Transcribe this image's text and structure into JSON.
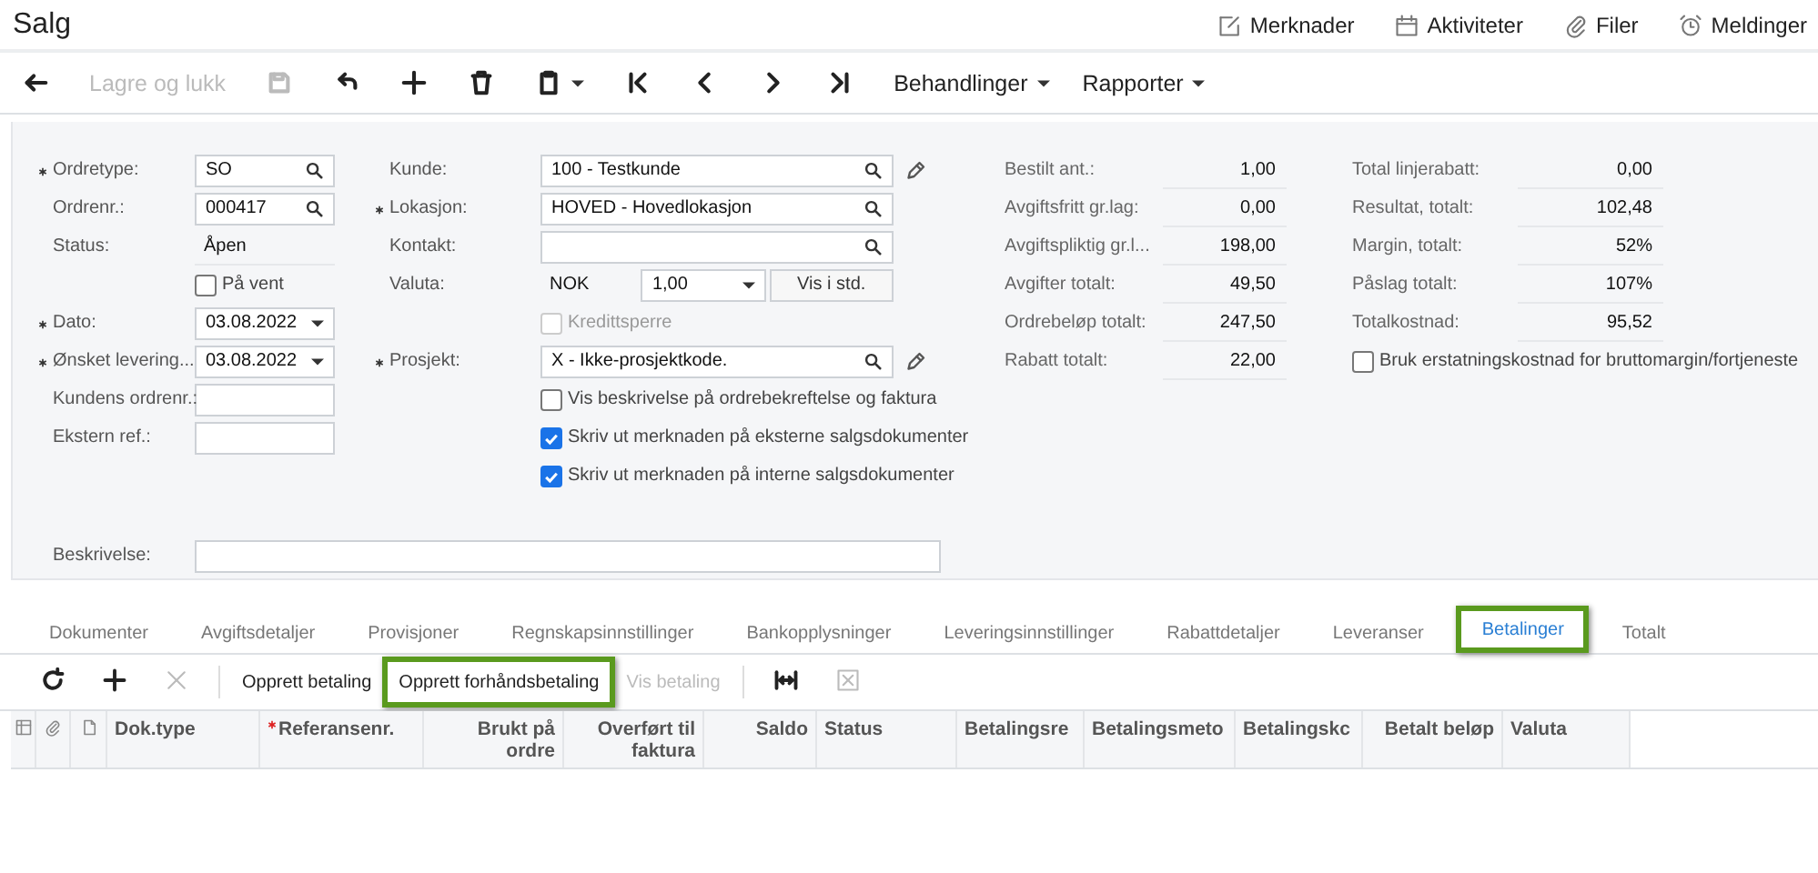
{
  "window": {
    "title": "Salg"
  },
  "header_links": [
    {
      "label": "Merknader"
    },
    {
      "label": "Aktiviteter"
    },
    {
      "label": "Filer"
    },
    {
      "label": "Meldinger"
    }
  ],
  "toolbar": [
    {
      "kind": "icon",
      "disabled": false
    },
    {
      "kind": "text",
      "label": "Lagre og lukk",
      "disabled": true
    },
    {
      "kind": "icon",
      "disabled": true
    },
    {
      "kind": "icon",
      "disabled": false
    },
    {
      "kind": "icon",
      "disabled": false
    },
    {
      "kind": "icon",
      "disabled": false
    },
    {
      "kind": "icon-menu",
      "disabled": false
    },
    {
      "kind": "icon",
      "disabled": false
    },
    {
      "kind": "icon",
      "disabled": false
    },
    {
      "kind": "icon",
      "disabled": false
    },
    {
      "kind": "icon",
      "disabled": false
    },
    {
      "kind": "menu",
      "label": "Behandlinger",
      "disabled": false
    },
    {
      "kind": "menu",
      "label": "Rapporter",
      "disabled": false
    }
  ],
  "form": {
    "column_1": [
      {
        "kind": "lookup",
        "label": "Ordretype:",
        "required": true,
        "value": "SO"
      },
      {
        "kind": "lookup",
        "label": "Ordrenr.:",
        "required": false,
        "value": "000417"
      },
      {
        "kind": "text",
        "label": "Status:",
        "required": false,
        "value": "Åpen"
      },
      {
        "kind": "checkbox",
        "label": "På vent",
        "checked": false,
        "disabled": false
      },
      {
        "kind": "date",
        "label": "Dato:",
        "required": true,
        "value": "03.08.2022"
      },
      {
        "kind": "date",
        "label": "Ønsket levering...",
        "required": true,
        "value": "03.08.2022"
      },
      {
        "kind": "input",
        "label": "Kundens ordrenr.:",
        "required": false
      },
      {
        "kind": "input",
        "label": "Ekstern ref.:",
        "required": false
      }
    ],
    "column_2": [
      {
        "kind": "lookup",
        "label": "Kunde:",
        "required": false,
        "value": "100 - Testkunde",
        "editable": true
      },
      {
        "kind": "lookup",
        "label": "Lokasjon:",
        "required": true,
        "value": "HOVED - Hovedlokasjon",
        "editable": false
      },
      {
        "kind": "lookup",
        "label": "Kontakt:",
        "required": false,
        "editable": false
      },
      {
        "kind": "currency",
        "label": "Valuta:",
        "required": false,
        "value": "NOK",
        "rate": "1,00",
        "button": "Vis i std."
      },
      {
        "kind": "checkbox",
        "label": "Kredittsperre",
        "checked": false,
        "disabled": true
      },
      {
        "kind": "lookup",
        "label": "Prosjekt:",
        "required": true,
        "value": "X - Ikke-prosjektkode.",
        "editable": true
      },
      {
        "kind": "checkbox",
        "label": "Vis beskrivelse på ordrebekreftelse og faktura",
        "checked": false,
        "disabled": false
      },
      {
        "kind": "checkbox",
        "label": "Skriv ut merknaden på eksterne salgsdokumenter",
        "checked": true,
        "disabled": false
      },
      {
        "kind": "checkbox",
        "label": "Skriv ut merknaden på interne salgsdokumenter",
        "checked": true,
        "disabled": false
      }
    ],
    "column_3": [
      {
        "kind": "amount",
        "label": "Bestilt ant.:",
        "value": "1,00"
      },
      {
        "kind": "amount",
        "label": "Avgiftsfritt gr.lag:",
        "value": "0,00"
      },
      {
        "kind": "amount",
        "label": "Avgiftspliktig gr.l...",
        "value": "198,00"
      },
      {
        "kind": "amount",
        "label": "Avgifter totalt:",
        "value": "49,50"
      },
      {
        "kind": "amount",
        "label": "Ordrebeløp totalt:",
        "value": "247,50"
      },
      {
        "kind": "amount",
        "label": "Rabatt totalt:",
        "value": "22,00"
      }
    ],
    "column_4": [
      {
        "kind": "amount",
        "label": "Total linjerabatt:",
        "value": "0,00"
      },
      {
        "kind": "amount",
        "label": "Resultat, totalt:",
        "value": "102,48"
      },
      {
        "kind": "amount",
        "label": "Margin, totalt:",
        "value": "52%"
      },
      {
        "kind": "amount",
        "label": "Påslag totalt:",
        "value": "107%"
      },
      {
        "kind": "amount",
        "label": "Totalkostnad:",
        "value": "95,52"
      },
      {
        "kind": "checkbox",
        "label": "Bruk erstatningskostnad for bruttomargin/fortjeneste",
        "checked": false,
        "disabled": false
      }
    ],
    "description": {
      "label": "Beskrivelse:"
    }
  },
  "tabs": [
    {
      "label": "Dokumenter",
      "selected": false,
      "highlighted": false
    },
    {
      "label": "Avgiftsdetaljer",
      "selected": false,
      "highlighted": false
    },
    {
      "label": "Provisjoner",
      "selected": false,
      "highlighted": false
    },
    {
      "label": "Regnskapsinnstillinger",
      "selected": false,
      "highlighted": false
    },
    {
      "label": "Bankopplysninger",
      "selected": false,
      "highlighted": false
    },
    {
      "label": "Leveringsinnstillinger",
      "selected": false,
      "highlighted": false
    },
    {
      "label": "Rabattdetaljer",
      "selected": false,
      "highlighted": false
    },
    {
      "label": "Leveranser",
      "selected": false,
      "highlighted": false
    },
    {
      "label": "Betalinger",
      "selected": true,
      "highlighted": true
    },
    {
      "label": "Totalt",
      "selected": false,
      "highlighted": false
    }
  ],
  "grid_toolbar": [
    {
      "kind": "icon",
      "disabled": false,
      "highlighted": false
    },
    {
      "kind": "icon",
      "disabled": false,
      "highlighted": false
    },
    {
      "kind": "icon",
      "disabled": true,
      "highlighted": false
    },
    {
      "kind": "separator"
    },
    {
      "kind": "text",
      "label": "Opprett betaling",
      "disabled": false,
      "highlighted": false
    },
    {
      "kind": "text",
      "label": "Opprett forhåndsbetaling",
      "disabled": false,
      "highlighted": true
    },
    {
      "kind": "text",
      "label": "Vis betaling",
      "disabled": true,
      "highlighted": false
    },
    {
      "kind": "separator"
    },
    {
      "kind": "icon",
      "disabled": false,
      "highlighted": false
    },
    {
      "kind": "icon",
      "disabled": true,
      "highlighted": false
    }
  ],
  "table": {
    "columns": [
      {
        "kind": "icon"
      },
      {
        "kind": "icon"
      },
      {
        "kind": "icon"
      },
      {
        "kind": "text",
        "label": "Dok.type",
        "required": false
      },
      {
        "kind": "text",
        "label": "Referansenr.",
        "required": true
      },
      {
        "kind": "text",
        "label": "Brukt på ordre",
        "required": false
      },
      {
        "kind": "text",
        "label": "Overført til faktura",
        "required": false
      },
      {
        "kind": "text",
        "label": "Saldo",
        "required": false
      },
      {
        "kind": "text",
        "label": "Status",
        "required": false
      },
      {
        "kind": "text",
        "label": "Betalingsre",
        "required": false
      },
      {
        "kind": "text",
        "label": "Betalingsmeto",
        "required": false
      },
      {
        "kind": "text",
        "label": "Betalingskc",
        "required": false
      },
      {
        "kind": "text",
        "label": "Betalt beløp",
        "required": false
      },
      {
        "kind": "text",
        "label": "Valuta",
        "required": false
      }
    ]
  }
}
